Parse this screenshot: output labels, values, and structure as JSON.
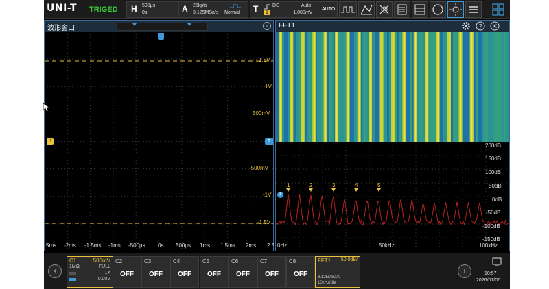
{
  "brand": {
    "logo": "UNI-T",
    "trigger_status": "TRIGED",
    "trigger_color": "#39c934"
  },
  "horizontal": {
    "label": "H",
    "time_base": "500μs",
    "offset": "0s"
  },
  "acquire": {
    "label": "A",
    "points": "25kpts",
    "sample_rate": "3.125MSa/s",
    "mode": "Normal"
  },
  "trigger": {
    "label": "T",
    "coupling": "DC",
    "source": "1",
    "mode": "Auto",
    "level": "-1.000mV"
  },
  "toolbar": {
    "auto_label": "AUTO",
    "icons": [
      "run-waveform-icon",
      "measure-icon",
      "cursor-icon",
      "math-icon",
      "table-icon",
      "circle-icon",
      "brightness-icon",
      "settings-icon",
      "grid-icon"
    ]
  },
  "waveform": {
    "title": "波形窗口",
    "y_labels": [
      "1.5V",
      "1V",
      "500mV",
      "-500mV",
      "-1V",
      "-1.5V"
    ],
    "x_labels": [
      "5ms",
      "-2ms",
      "-1.5ms",
      "-1ms",
      "-500μs",
      "0s",
      "500μs",
      "1ms",
      "1.5ms",
      "2ms",
      "2.5"
    ],
    "trigger_marker": "T",
    "channel_marker": "1",
    "trace_color": "#e8c23c"
  },
  "fft": {
    "title": "FFT1",
    "db_labels": [
      "200dB",
      "150dB",
      "100dB",
      "50dB",
      "0dB",
      "-50dB",
      "-100dB",
      "-150dB"
    ],
    "f_labels": [
      "0Hz",
      "50kHz",
      "100kHz"
    ],
    "peaks": [
      "1",
      "2",
      "3",
      "4",
      "5"
    ],
    "channel_marker": "1",
    "trace_color": "#b82222"
  },
  "channels": [
    {
      "name": "C1",
      "value": "500mV",
      "line2_left": "1MΩ",
      "line2_right": "FULL",
      "line3": "1X",
      "line4": "0.00V",
      "active": true
    },
    {
      "name": "C2",
      "value": "OFF"
    },
    {
      "name": "C3",
      "value": "OFF"
    },
    {
      "name": "C4",
      "value": "OFF"
    },
    {
      "name": "C5",
      "value": "OFF"
    },
    {
      "name": "C6",
      "value": "OFF"
    },
    {
      "name": "C7",
      "value": "OFF"
    },
    {
      "name": "C8",
      "value": "OFF"
    }
  ],
  "fft_chip": {
    "name": "FFT1",
    "value": "50.0dB/",
    "rate": "3.125MSa/s",
    "res": "10kHz/div"
  },
  "clock": {
    "time": "10:57",
    "date": "2026/01/06"
  }
}
